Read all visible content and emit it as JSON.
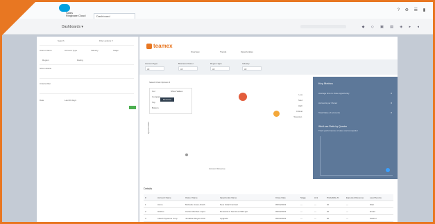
{
  "window": {
    "app_name_line1": "Sales",
    "app_name_line2": "Ringbase Cloud",
    "tab_label": "Dashboard",
    "title_icons": "? ⚙ ☰ ▮"
  },
  "subheader": {
    "title": "Dashboards ▾",
    "icons": "◆ ◇ ▣ ▤ ◈ ▸ ◂"
  },
  "left_panel": {
    "search_placeholder": "Search",
    "dropdown_label": "Filter options ▾",
    "rows": [
      "Owner Name",
      "Account Type",
      "Industry",
      "Stage",
      "Region",
      "Rating"
    ],
    "section_a": "Show details",
    "section_b": "Criteria filter",
    "field_label": "Date",
    "field_value": "Last 30 days"
  },
  "main": {
    "logo": "teamex",
    "tabs": [
      "Overview",
      "Trends",
      "Opportunities"
    ],
    "filters": [
      {
        "label": "Account Type",
        "value": "All"
      },
      {
        "label": "Business Owner",
        "value": "All"
      },
      {
        "label": "Region Type",
        "value": "All"
      },
      {
        "label": "Industry",
        "value": "All"
      }
    ],
    "dropdown": "Select Chart Options ▾",
    "dropdown_items": [
      "Col",
      "Show Values",
      "Compare",
      "Top",
      "Bottom"
    ],
    "tooltip": "Revenue",
    "x_axis_label": "Account Revenue",
    "y_axis_label": "Opportunities",
    "legend_items": [
      "Low",
      "Med",
      "High",
      "Critical",
      "Total Acc."
    ]
  },
  "right_panel": {
    "title": "Key Metrics",
    "rows": [
      {
        "label": "Average time to close opportunity",
        "value": "0"
      },
      {
        "label": "Accounts per Owner",
        "value": "0"
      },
      {
        "label": "Total Value of Accounts",
        "value": "0"
      }
    ],
    "sub_title": "Win/Loss Ratio by Quarter",
    "sub_text": "Track performance of sales and competitor"
  },
  "details": {
    "title": "Details",
    "columns": [
      "#",
      "Account Name",
      "Owner Name",
      "Opportunity Name",
      "Close Date",
      "Stage",
      "Amt",
      "Probability %",
      "Expected Revenue",
      "Lead Source"
    ],
    "rows": [
      [
        "1",
        "Acme",
        "Michelle Jones-Smith",
        "New Initial Contract",
        "05/16/2023",
        "—",
        "—",
        "40",
        "—",
        "Web"
      ],
      [
        "2",
        "Globex",
        "Carlos Mendez-Lopez",
        "Renewal of Services 2023 Q3",
        "05/16/2023",
        "—",
        "—",
        "20",
        "—",
        "Email"
      ],
      [
        "3",
        "Initech Systems Corp",
        "Jonathan Reyes-Ortiz",
        "Upgrade",
        "05/16/2023",
        "—",
        "—",
        "60",
        "—",
        "Partner"
      ]
    ]
  },
  "colors": {
    "accent": "#e87722",
    "bubble_high": "#e35d3c",
    "bubble_med": "#f4a83a",
    "panel": "#5d7899"
  }
}
